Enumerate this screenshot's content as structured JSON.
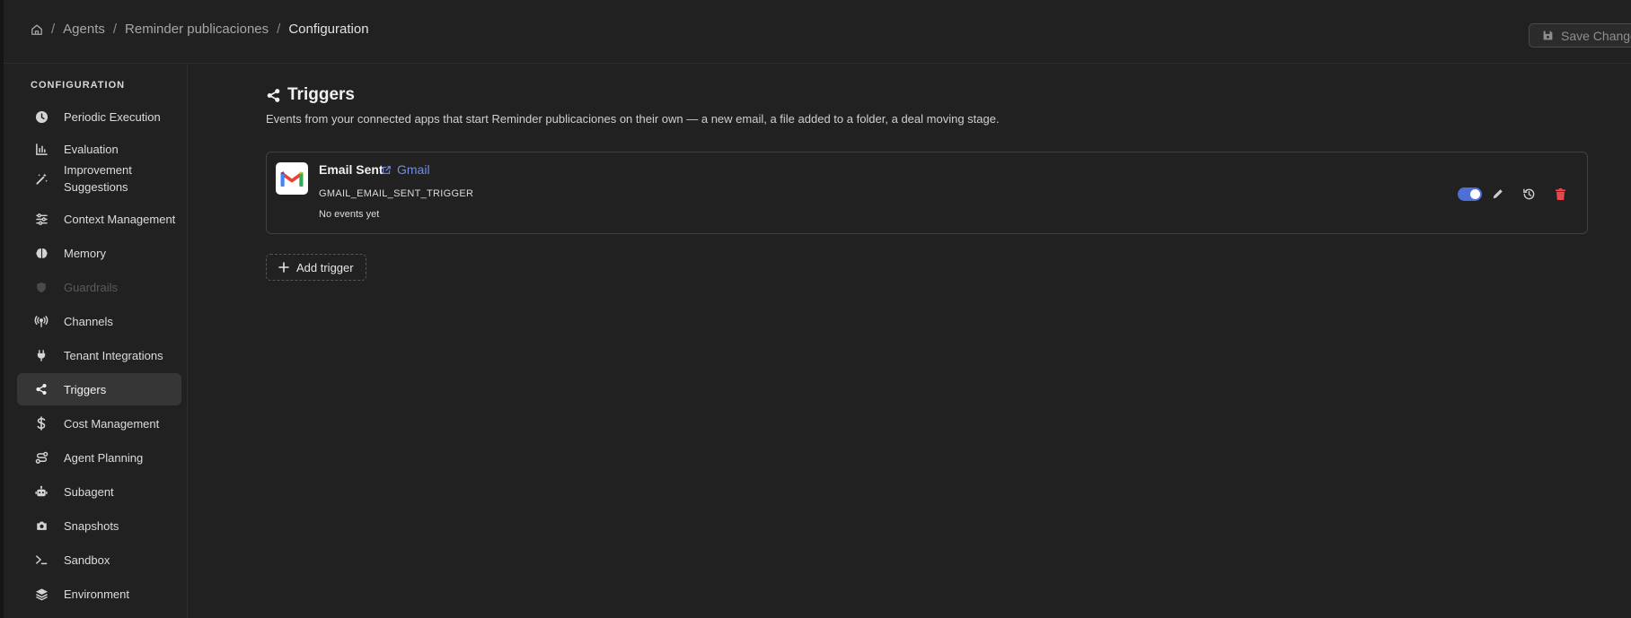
{
  "breadcrumb": {
    "home_icon": "home-icon",
    "items": [
      "Agents",
      "Reminder publicaciones",
      "Configuration"
    ],
    "separator": "/"
  },
  "toolbar": {
    "save_label": "Save Changes",
    "save_icon": "floppy-disk-icon"
  },
  "sidebar": {
    "heading": "CONFIGURATION",
    "items": [
      {
        "label": "Periodic Execution",
        "icon": "clock-icon"
      },
      {
        "label": "Evaluation",
        "icon": "bar-chart-icon"
      },
      {
        "label": "Improvement Suggestions",
        "icon": "magic-wand-icon"
      },
      {
        "label": "Context Management",
        "icon": "sliders-icon"
      },
      {
        "label": "Memory",
        "icon": "brain-icon"
      },
      {
        "label": "Guardrails",
        "icon": "shield-icon",
        "state": "disabled"
      },
      {
        "label": "Channels",
        "icon": "broadcast-antenna-icon"
      },
      {
        "label": "Tenant Integrations",
        "icon": "plug-icon"
      },
      {
        "label": "Triggers",
        "icon": "share-nodes-icon",
        "state": "active"
      },
      {
        "label": "Cost Management",
        "icon": "dollar-icon"
      },
      {
        "label": "Agent Planning",
        "icon": "route-icon"
      },
      {
        "label": "Subagent",
        "icon": "robot-icon"
      },
      {
        "label": "Snapshots",
        "icon": "camera-icon"
      },
      {
        "label": "Sandbox",
        "icon": "terminal-icon"
      },
      {
        "label": "Environment",
        "icon": "layers-icon"
      }
    ]
  },
  "main": {
    "title": "Triggers",
    "title_icon": "share-nodes-icon",
    "description": "Events from your connected apps that start Reminder publicaciones on their own — a new email, a file added to a folder, a deal moving stage.",
    "triggers": [
      {
        "name": "Email Sent",
        "app": "Gmail",
        "app_icon": "gmail-logo-icon",
        "slug": "GMAIL_EMAIL_SENT_TRIGGER",
        "status": "No events yet",
        "enabled": true
      }
    ],
    "add_trigger_label": "Add trigger"
  },
  "colors": {
    "background": "#212121",
    "accent": "#4e6fd6",
    "link": "#6f8ee8",
    "danger": "#e5484d",
    "active_nav": "#363636"
  }
}
